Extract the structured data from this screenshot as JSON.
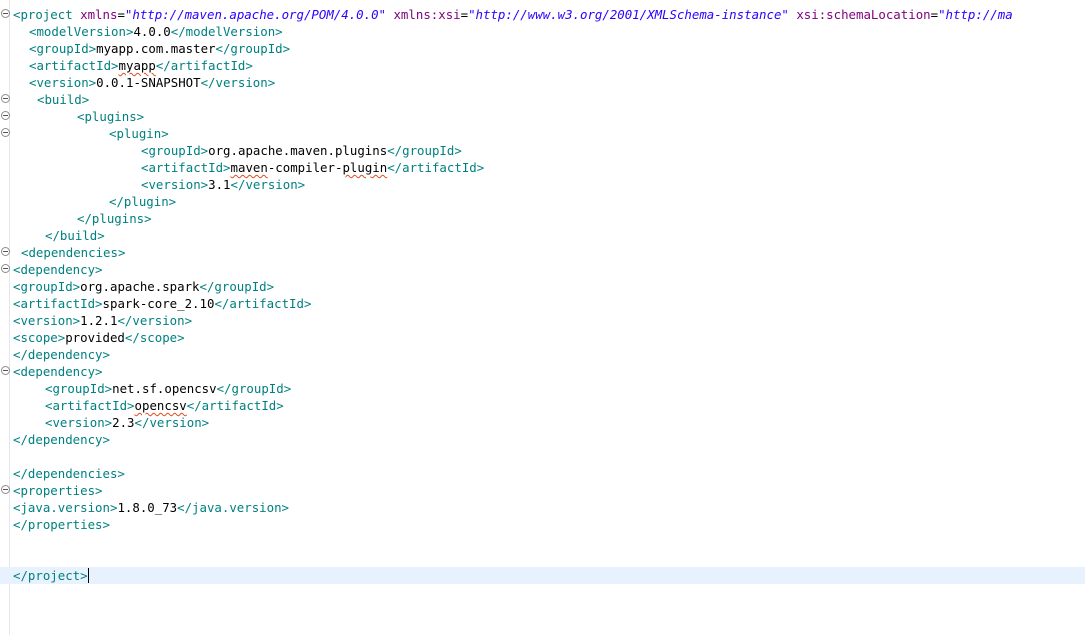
{
  "editor": {
    "lines": [
      {
        "fold": true,
        "indent": 13,
        "parts": [
          {
            "t": "<project ",
            "c": "tb"
          },
          {
            "t": "xmlns",
            "c": "an"
          },
          {
            "t": "=",
            "c": "tx"
          },
          {
            "t": "\"http://maven.apache.org/POM/4.0.0\"",
            "c": "av"
          },
          {
            "t": " xmlns:xsi",
            "c": "an"
          },
          {
            "t": "=",
            "c": "tx"
          },
          {
            "t": "\"http://www.w3.org/2001/XMLSchema-instance\"",
            "c": "av"
          },
          {
            "t": " xsi:schemaLocation",
            "c": "an"
          },
          {
            "t": "=",
            "c": "tx"
          },
          {
            "t": "\"http://ma",
            "c": "av"
          }
        ]
      },
      {
        "fold": false,
        "indent": 29,
        "parts": [
          {
            "t": "<modelVersion>",
            "c": "tb"
          },
          {
            "t": "4.0.0",
            "c": "tx"
          },
          {
            "t": "</modelVersion>",
            "c": "tb"
          }
        ]
      },
      {
        "fold": false,
        "indent": 29,
        "parts": [
          {
            "t": "<groupId>",
            "c": "tb"
          },
          {
            "t": "myapp.com.master",
            "c": "tx"
          },
          {
            "t": "</groupId>",
            "c": "tb"
          }
        ]
      },
      {
        "fold": false,
        "indent": 29,
        "parts": [
          {
            "t": "<artifactId>",
            "c": "tb"
          },
          {
            "t": "myapp",
            "c": "tx",
            "sq": true
          },
          {
            "t": "</artifactId>",
            "c": "tb"
          }
        ]
      },
      {
        "fold": false,
        "indent": 29,
        "parts": [
          {
            "t": "<version>",
            "c": "tb"
          },
          {
            "t": "0.0.1-SNAPSHOT",
            "c": "tx"
          },
          {
            "t": "</version>",
            "c": "tb"
          }
        ]
      },
      {
        "fold": true,
        "indent": 37,
        "parts": [
          {
            "t": "<build>",
            "c": "tb"
          }
        ]
      },
      {
        "fold": true,
        "indent": 77,
        "parts": [
          {
            "t": "<plugins>",
            "c": "tb"
          }
        ]
      },
      {
        "fold": true,
        "indent": 109,
        "parts": [
          {
            "t": "<plugin>",
            "c": "tb"
          }
        ]
      },
      {
        "fold": false,
        "indent": 141,
        "parts": [
          {
            "t": "<groupId>",
            "c": "tb"
          },
          {
            "t": "org.apache.maven.plugins",
            "c": "tx"
          },
          {
            "t": "</groupId>",
            "c": "tb"
          }
        ]
      },
      {
        "fold": false,
        "indent": 141,
        "parts": [
          {
            "t": "<artifactId>",
            "c": "tb"
          },
          {
            "t": "maven",
            "c": "tx",
            "sq": true
          },
          {
            "t": "-compiler-",
            "c": "tx"
          },
          {
            "t": "plugin",
            "c": "tx",
            "sq": true
          },
          {
            "t": "</artifactId>",
            "c": "tb"
          }
        ]
      },
      {
        "fold": false,
        "indent": 141,
        "parts": [
          {
            "t": "<version>",
            "c": "tb"
          },
          {
            "t": "3.1",
            "c": "tx"
          },
          {
            "t": "</version>",
            "c": "tb"
          }
        ]
      },
      {
        "fold": false,
        "indent": 109,
        "parts": [
          {
            "t": "</plugin>",
            "c": "tb"
          }
        ]
      },
      {
        "fold": false,
        "indent": 77,
        "parts": [
          {
            "t": "</plugins>",
            "c": "tb"
          }
        ]
      },
      {
        "fold": false,
        "indent": 45,
        "parts": [
          {
            "t": "</build>",
            "c": "tb"
          }
        ]
      },
      {
        "fold": true,
        "indent": 21,
        "parts": [
          {
            "t": "<dependencies>",
            "c": "tb"
          }
        ]
      },
      {
        "fold": true,
        "indent": 13,
        "parts": [
          {
            "t": "<dependency>",
            "c": "tb"
          }
        ]
      },
      {
        "fold": false,
        "indent": 13,
        "parts": [
          {
            "t": "<groupId>",
            "c": "tb"
          },
          {
            "t": "org.apache.spark",
            "c": "tx"
          },
          {
            "t": "</groupId>",
            "c": "tb"
          }
        ]
      },
      {
        "fold": false,
        "indent": 13,
        "parts": [
          {
            "t": "<artifactId>",
            "c": "tb"
          },
          {
            "t": "spark-core_2.10",
            "c": "tx"
          },
          {
            "t": "</artifactId>",
            "c": "tb"
          }
        ]
      },
      {
        "fold": false,
        "indent": 13,
        "parts": [
          {
            "t": "<version>",
            "c": "tb"
          },
          {
            "t": "1.2.1",
            "c": "tx"
          },
          {
            "t": "</version>",
            "c": "tb"
          }
        ]
      },
      {
        "fold": false,
        "indent": 13,
        "parts": [
          {
            "t": "<scope>",
            "c": "tb"
          },
          {
            "t": "provided",
            "c": "tx"
          },
          {
            "t": "</scope>",
            "c": "tb"
          }
        ]
      },
      {
        "fold": false,
        "indent": 13,
        "parts": [
          {
            "t": "</dependency>",
            "c": "tb"
          }
        ]
      },
      {
        "fold": true,
        "indent": 13,
        "parts": [
          {
            "t": "<dependency>",
            "c": "tb"
          }
        ]
      },
      {
        "fold": false,
        "indent": 45,
        "parts": [
          {
            "t": "<groupId>",
            "c": "tb"
          },
          {
            "t": "net.sf.opencsv",
            "c": "tx"
          },
          {
            "t": "</groupId>",
            "c": "tb"
          }
        ]
      },
      {
        "fold": false,
        "indent": 45,
        "parts": [
          {
            "t": "<artifactId>",
            "c": "tb"
          },
          {
            "t": "opencsv",
            "c": "tx",
            "sq": true
          },
          {
            "t": "</artifactId>",
            "c": "tb"
          }
        ]
      },
      {
        "fold": false,
        "indent": 45,
        "parts": [
          {
            "t": "<version>",
            "c": "tb"
          },
          {
            "t": "2.3",
            "c": "tx"
          },
          {
            "t": "</version>",
            "c": "tb"
          }
        ]
      },
      {
        "fold": false,
        "indent": 13,
        "parts": [
          {
            "t": "</dependency>",
            "c": "tb"
          }
        ]
      },
      {
        "fold": false,
        "indent": 13,
        "parts": []
      },
      {
        "fold": false,
        "indent": 13,
        "parts": [
          {
            "t": "</dependencies>",
            "c": "tb"
          }
        ]
      },
      {
        "fold": true,
        "indent": 13,
        "parts": [
          {
            "t": "<properties>",
            "c": "tb"
          }
        ]
      },
      {
        "fold": false,
        "indent": 13,
        "parts": [
          {
            "t": "<java.version>",
            "c": "tb"
          },
          {
            "t": "1.8.0_73",
            "c": "tx"
          },
          {
            "t": "</java.version>",
            "c": "tb"
          }
        ]
      },
      {
        "fold": false,
        "indent": 13,
        "parts": [
          {
            "t": "</properties>",
            "c": "tb"
          }
        ]
      },
      {
        "fold": false,
        "indent": 13,
        "parts": []
      },
      {
        "fold": false,
        "indent": 13,
        "parts": []
      },
      {
        "fold": false,
        "indent": 13,
        "current": true,
        "caret": true,
        "parts": [
          {
            "t": "</project>",
            "c": "tb"
          }
        ]
      }
    ]
  }
}
